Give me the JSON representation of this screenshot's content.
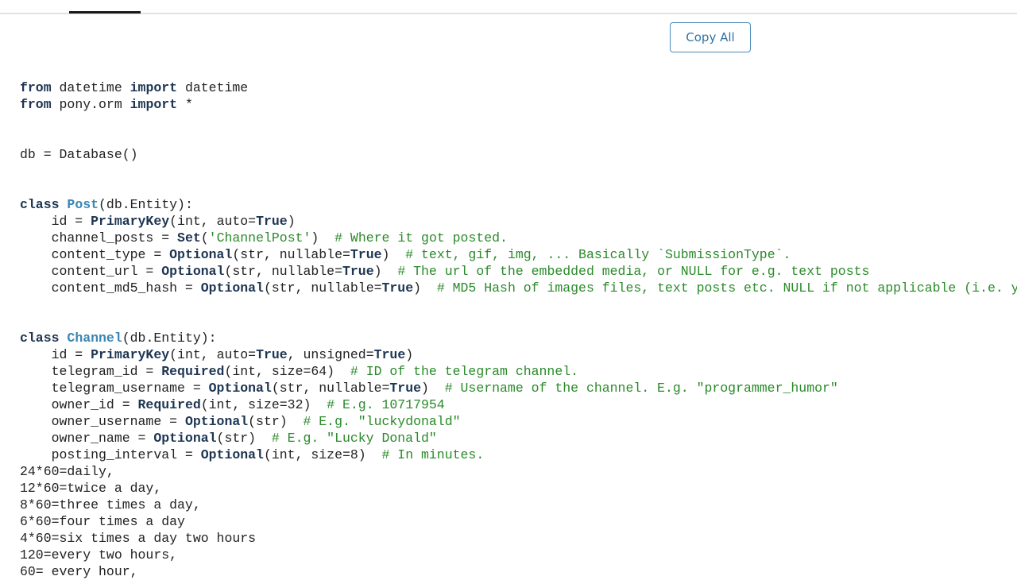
{
  "toolbar": {
    "copy_all_label": "Copy All"
  },
  "colors": {
    "keyword": "#1d3552",
    "class_name": "#3a87b5",
    "comment": "#2a8a2a",
    "button_border": "#4a8ab8"
  },
  "code_lines": [
    [
      [
        "k",
        "from"
      ],
      [
        "t",
        " datetime "
      ],
      [
        "k",
        "import"
      ],
      [
        "t",
        " datetime"
      ]
    ],
    [
      [
        "k",
        "from"
      ],
      [
        "t",
        " pony.orm "
      ],
      [
        "k",
        "import"
      ],
      [
        "t",
        " *"
      ]
    ],
    [],
    [],
    [
      [
        "t",
        "db = Database()"
      ]
    ],
    [],
    [],
    [
      [
        "k",
        "class"
      ],
      [
        "t",
        " "
      ],
      [
        "c",
        "Post"
      ],
      [
        "t",
        "(db.Entity):"
      ]
    ],
    [
      [
        "t",
        "    id = "
      ],
      [
        "k",
        "PrimaryKey"
      ],
      [
        "t",
        "(int, auto="
      ],
      [
        "k",
        "True"
      ],
      [
        "t",
        ")"
      ]
    ],
    [
      [
        "t",
        "    channel_posts = "
      ],
      [
        "k",
        "Set"
      ],
      [
        "t",
        "("
      ],
      [
        "s",
        "'ChannelPost'"
      ],
      [
        "t",
        ")  "
      ],
      [
        "m",
        "# Where it got posted."
      ]
    ],
    [
      [
        "t",
        "    content_type = "
      ],
      [
        "k",
        "Optional"
      ],
      [
        "t",
        "(str, nullable="
      ],
      [
        "k",
        "True"
      ],
      [
        "t",
        ")  "
      ],
      [
        "m",
        "# text, gif, img, ... Basically `SubmissionType`."
      ]
    ],
    [
      [
        "t",
        "    content_url = "
      ],
      [
        "k",
        "Optional"
      ],
      [
        "t",
        "(str, nullable="
      ],
      [
        "k",
        "True"
      ],
      [
        "t",
        ")  "
      ],
      [
        "m",
        "# The url of the embedded media, or NULL for e.g. text posts"
      ]
    ],
    [
      [
        "t",
        "    content_md5_hash = "
      ],
      [
        "k",
        "Optional"
      ],
      [
        "t",
        "(str, nullable="
      ],
      [
        "k",
        "True"
      ],
      [
        "t",
        ")  "
      ],
      [
        "m",
        "# MD5 Hash of images files, text posts etc. NULL if not applicable (i.e. y"
      ]
    ],
    [],
    [],
    [
      [
        "k",
        "class"
      ],
      [
        "t",
        " "
      ],
      [
        "c",
        "Channel"
      ],
      [
        "t",
        "(db.Entity):"
      ]
    ],
    [
      [
        "t",
        "    id = "
      ],
      [
        "k",
        "PrimaryKey"
      ],
      [
        "t",
        "(int, auto="
      ],
      [
        "k",
        "True"
      ],
      [
        "t",
        ", unsigned="
      ],
      [
        "k",
        "True"
      ],
      [
        "t",
        ")"
      ]
    ],
    [
      [
        "t",
        "    telegram_id = "
      ],
      [
        "k",
        "Required"
      ],
      [
        "t",
        "(int, size=64)  "
      ],
      [
        "m",
        "# ID of the telegram channel."
      ]
    ],
    [
      [
        "t",
        "    telegram_username = "
      ],
      [
        "k",
        "Optional"
      ],
      [
        "t",
        "(str, nullable="
      ],
      [
        "k",
        "True"
      ],
      [
        "t",
        ")  "
      ],
      [
        "m",
        "# Username of the channel. E.g. \"programmer_humor\""
      ]
    ],
    [
      [
        "t",
        "    owner_id = "
      ],
      [
        "k",
        "Required"
      ],
      [
        "t",
        "(int, size=32)  "
      ],
      [
        "m",
        "# E.g. 10717954"
      ]
    ],
    [
      [
        "t",
        "    owner_username = "
      ],
      [
        "k",
        "Optional"
      ],
      [
        "t",
        "(str)  "
      ],
      [
        "m",
        "# E.g. \"luckydonald\""
      ]
    ],
    [
      [
        "t",
        "    owner_name = "
      ],
      [
        "k",
        "Optional"
      ],
      [
        "t",
        "(str)  "
      ],
      [
        "m",
        "# E.g. \"Lucky Donald\""
      ]
    ],
    [
      [
        "t",
        "    posting_interval = "
      ],
      [
        "k",
        "Optional"
      ],
      [
        "t",
        "(int, size=8)  "
      ],
      [
        "m",
        "# In minutes."
      ]
    ],
    [
      [
        "t",
        "24*60=daily,"
      ]
    ],
    [
      [
        "t",
        "12*60=twice a day,"
      ]
    ],
    [
      [
        "t",
        "8*60=three times a day,"
      ]
    ],
    [
      [
        "t",
        "6*60=four times a day"
      ]
    ],
    [
      [
        "t",
        "4*60=six times a day two hours"
      ]
    ],
    [
      [
        "t",
        "120=every two hours,"
      ]
    ],
    [
      [
        "t",
        "60= every hour,"
      ]
    ]
  ]
}
